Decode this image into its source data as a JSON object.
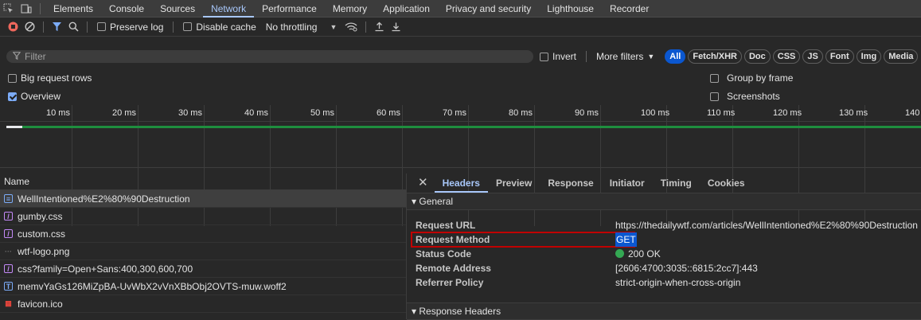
{
  "panel_tabs": [
    "Elements",
    "Console",
    "Sources",
    "Network",
    "Performance",
    "Memory",
    "Application",
    "Privacy and security",
    "Lighthouse",
    "Recorder"
  ],
  "active_panel_tab": "Network",
  "toolbar": {
    "preserve_log": "Preserve log",
    "disable_cache": "Disable cache",
    "throttling": "No throttling"
  },
  "filter": {
    "placeholder": "Filter",
    "invert": "Invert",
    "more_filters": "More filters",
    "types": [
      "All",
      "Fetch/XHR",
      "Doc",
      "CSS",
      "JS",
      "Font",
      "Img",
      "Media"
    ]
  },
  "settings": {
    "big_request_rows": "Big request rows",
    "overview": "Overview",
    "group_by_frame": "Group by frame",
    "screenshots": "Screenshots"
  },
  "timeline_ticks": [
    "10 ms",
    "20 ms",
    "30 ms",
    "40 ms",
    "50 ms",
    "60 ms",
    "70 ms",
    "80 ms",
    "90 ms",
    "100 ms",
    "110 ms",
    "120 ms",
    "130 ms",
    "140 ms"
  ],
  "request_list": {
    "header": "Name",
    "rows": [
      {
        "name": "WellIntentioned%E2%80%90Destruction",
        "icon": "document-icon",
        "color": "#7cacf8"
      },
      {
        "name": "gumby.css",
        "icon": "css-icon",
        "color": "#c58af9"
      },
      {
        "name": "custom.css",
        "icon": "css-icon",
        "color": "#c58af9"
      },
      {
        "name": "wtf-logo.png",
        "icon": "image-icon",
        "color": "#6d6d6d"
      },
      {
        "name": "css?family=Open+Sans:400,300,600,700",
        "icon": "css-icon",
        "color": "#c58af9"
      },
      {
        "name": "memvYaGs126MiZpBA-UvWbX2vVnXBbObj2OVTS-muw.woff2",
        "icon": "font-icon",
        "color": "#7cacf8"
      },
      {
        "name": "favicon.ico",
        "icon": "favicon-icon",
        "color": "#e8453c"
      }
    ]
  },
  "details": {
    "tabs": [
      "Headers",
      "Preview",
      "Response",
      "Initiator",
      "Timing",
      "Cookies"
    ],
    "active_tab": "Headers",
    "general_title": "▾ General",
    "general": [
      {
        "key": "Request URL",
        "value": "https://thedailywtf.com/articles/WellIntentioned%E2%80%90Destruction"
      },
      {
        "key": "Request Method",
        "value": "GET"
      },
      {
        "key": "Status Code",
        "value": "200 OK"
      },
      {
        "key": "Remote Address",
        "value": "[2606:4700:3035::6815:2cc7]:443"
      },
      {
        "key": "Referrer Policy",
        "value": "strict-origin-when-cross-origin"
      }
    ],
    "response_headers_title": "▾ Response Headers"
  },
  "colors": {
    "accent": "#a8c7fa",
    "highlight": "#c00000",
    "status_ok": "#34a853"
  }
}
